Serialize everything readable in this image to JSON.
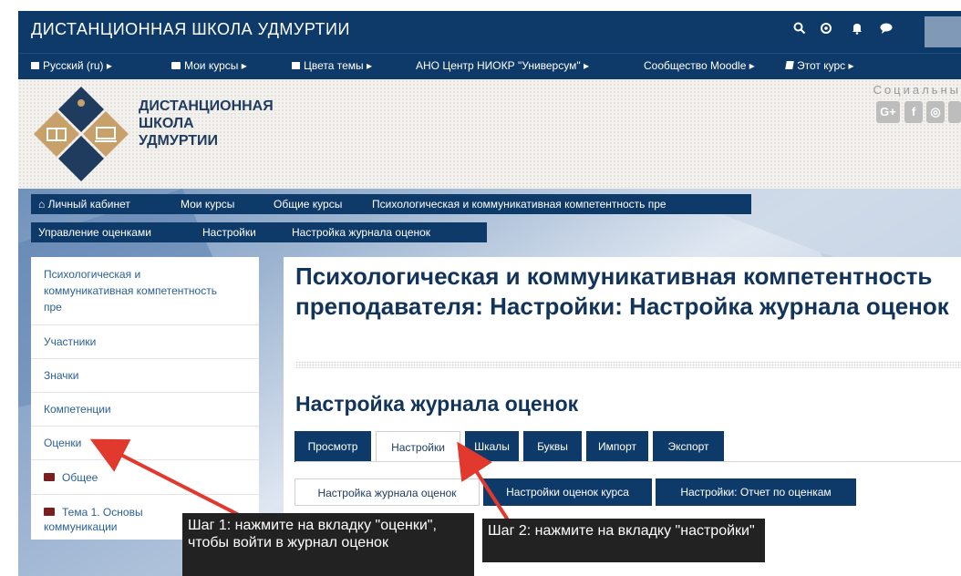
{
  "topbar": {
    "site_title": "ДИСТАНЦИОННАЯ ШКОЛА УДМУРТИИ",
    "icons": [
      "search-icon",
      "target-icon",
      "bell-icon",
      "chat-icon"
    ]
  },
  "menu": {
    "items": [
      {
        "icon": "flag-icon",
        "label": "Русский (ru) ▸"
      },
      {
        "icon": "briefcase-icon",
        "label": "Мои курсы ▸"
      },
      {
        "icon": "grid-icon",
        "label": "Цвета темы ▸"
      },
      {
        "icon": "",
        "label": "АНО Центр НИОКР \"Универсум\" ▸"
      },
      {
        "icon": "",
        "label": "Сообщество Moodle ▸"
      },
      {
        "icon": "book-icon",
        "label": "Этот курс ▸"
      }
    ]
  },
  "header": {
    "logo_line1": "ДИСТАНЦИОННАЯ",
    "logo_line2": "ШКОЛА",
    "logo_line3": "УДМУРТИИ",
    "social_label": "Социальны",
    "social_icons": [
      "G+",
      "f",
      "◎"
    ]
  },
  "breadcrumb": {
    "row1": [
      "Личный кабинет",
      "Мои курсы",
      "Общие курсы",
      "Психологическая и коммуникативная компетентность пре"
    ],
    "row2": [
      "Управление оценками",
      "Настройки",
      "Настройка журнала оценок"
    ]
  },
  "sidebar": {
    "items": [
      {
        "label": "Психологическая и коммуникативная компетентность пре"
      },
      {
        "label": "Участники"
      },
      {
        "label": "Значки"
      },
      {
        "label": "Компетенции"
      },
      {
        "label": "Оценки"
      },
      {
        "label": "Общее"
      },
      {
        "label": "Тема 1. Основы коммуникации"
      }
    ]
  },
  "main": {
    "page_title": "Психологическая и коммуникативная компетентность преподавателя: Настройки: Настройка журнала оценок",
    "section_title": "Настройка журнала оценок",
    "tabs": [
      "Просмотр",
      "Настройки",
      "Шкалы",
      "Буквы",
      "Импорт",
      "Экспорт"
    ],
    "active_tab": "Настройки",
    "subtabs": [
      "Настройка журнала оценок",
      "Настройки оценок курса",
      "Настройки: Отчет по оценкам"
    ]
  },
  "callouts": {
    "step1": "Шаг 1: нажмите на вкладку \"оценки\", чтобы войти в журнал оценок",
    "step2": "Шаг 2: нажмите на вкладку \"настройки\""
  },
  "colors": {
    "navy": "#0e3a6a",
    "link": "#2a5f98",
    "title": "#12335a",
    "arrow": "#e2392f",
    "callout_bg": "#222222"
  }
}
